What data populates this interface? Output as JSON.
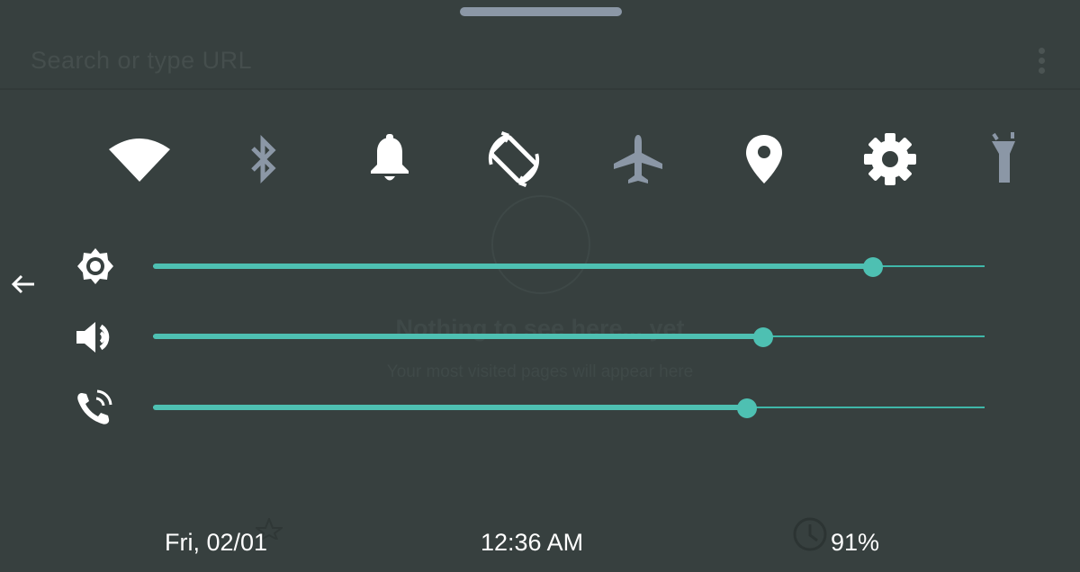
{
  "browser": {
    "url_placeholder": "Search or type URL",
    "empty_state_title": "Nothing to see here... yet",
    "empty_state_subtitle": "Your most visited pages will appear here"
  },
  "quick_settings": {
    "tiles": [
      {
        "icon": "wifi-icon",
        "state": "on"
      },
      {
        "icon": "bluetooth-icon",
        "state": "off"
      },
      {
        "icon": "bell-icon",
        "state": "on"
      },
      {
        "icon": "auto-rotate-icon",
        "state": "on"
      },
      {
        "icon": "airplane-icon",
        "state": "off"
      },
      {
        "icon": "location-icon",
        "state": "on"
      },
      {
        "icon": "settings-icon",
        "state": "on"
      },
      {
        "icon": "flashlight-icon",
        "state": "off"
      }
    ]
  },
  "sliders": [
    {
      "icon": "brightness-icon",
      "level": 0.866
    },
    {
      "icon": "media-volume-icon",
      "level": 0.734
    },
    {
      "icon": "ring-volume-icon",
      "level": 0.714
    }
  ],
  "status": {
    "date": "Fri, 02/01",
    "time": "12:36 AM",
    "battery": "91%"
  },
  "colors": {
    "background": "#37403f",
    "accent": "#4ec0b2",
    "tile_on": "#ffffff",
    "tile_off": "#8b97a6"
  }
}
